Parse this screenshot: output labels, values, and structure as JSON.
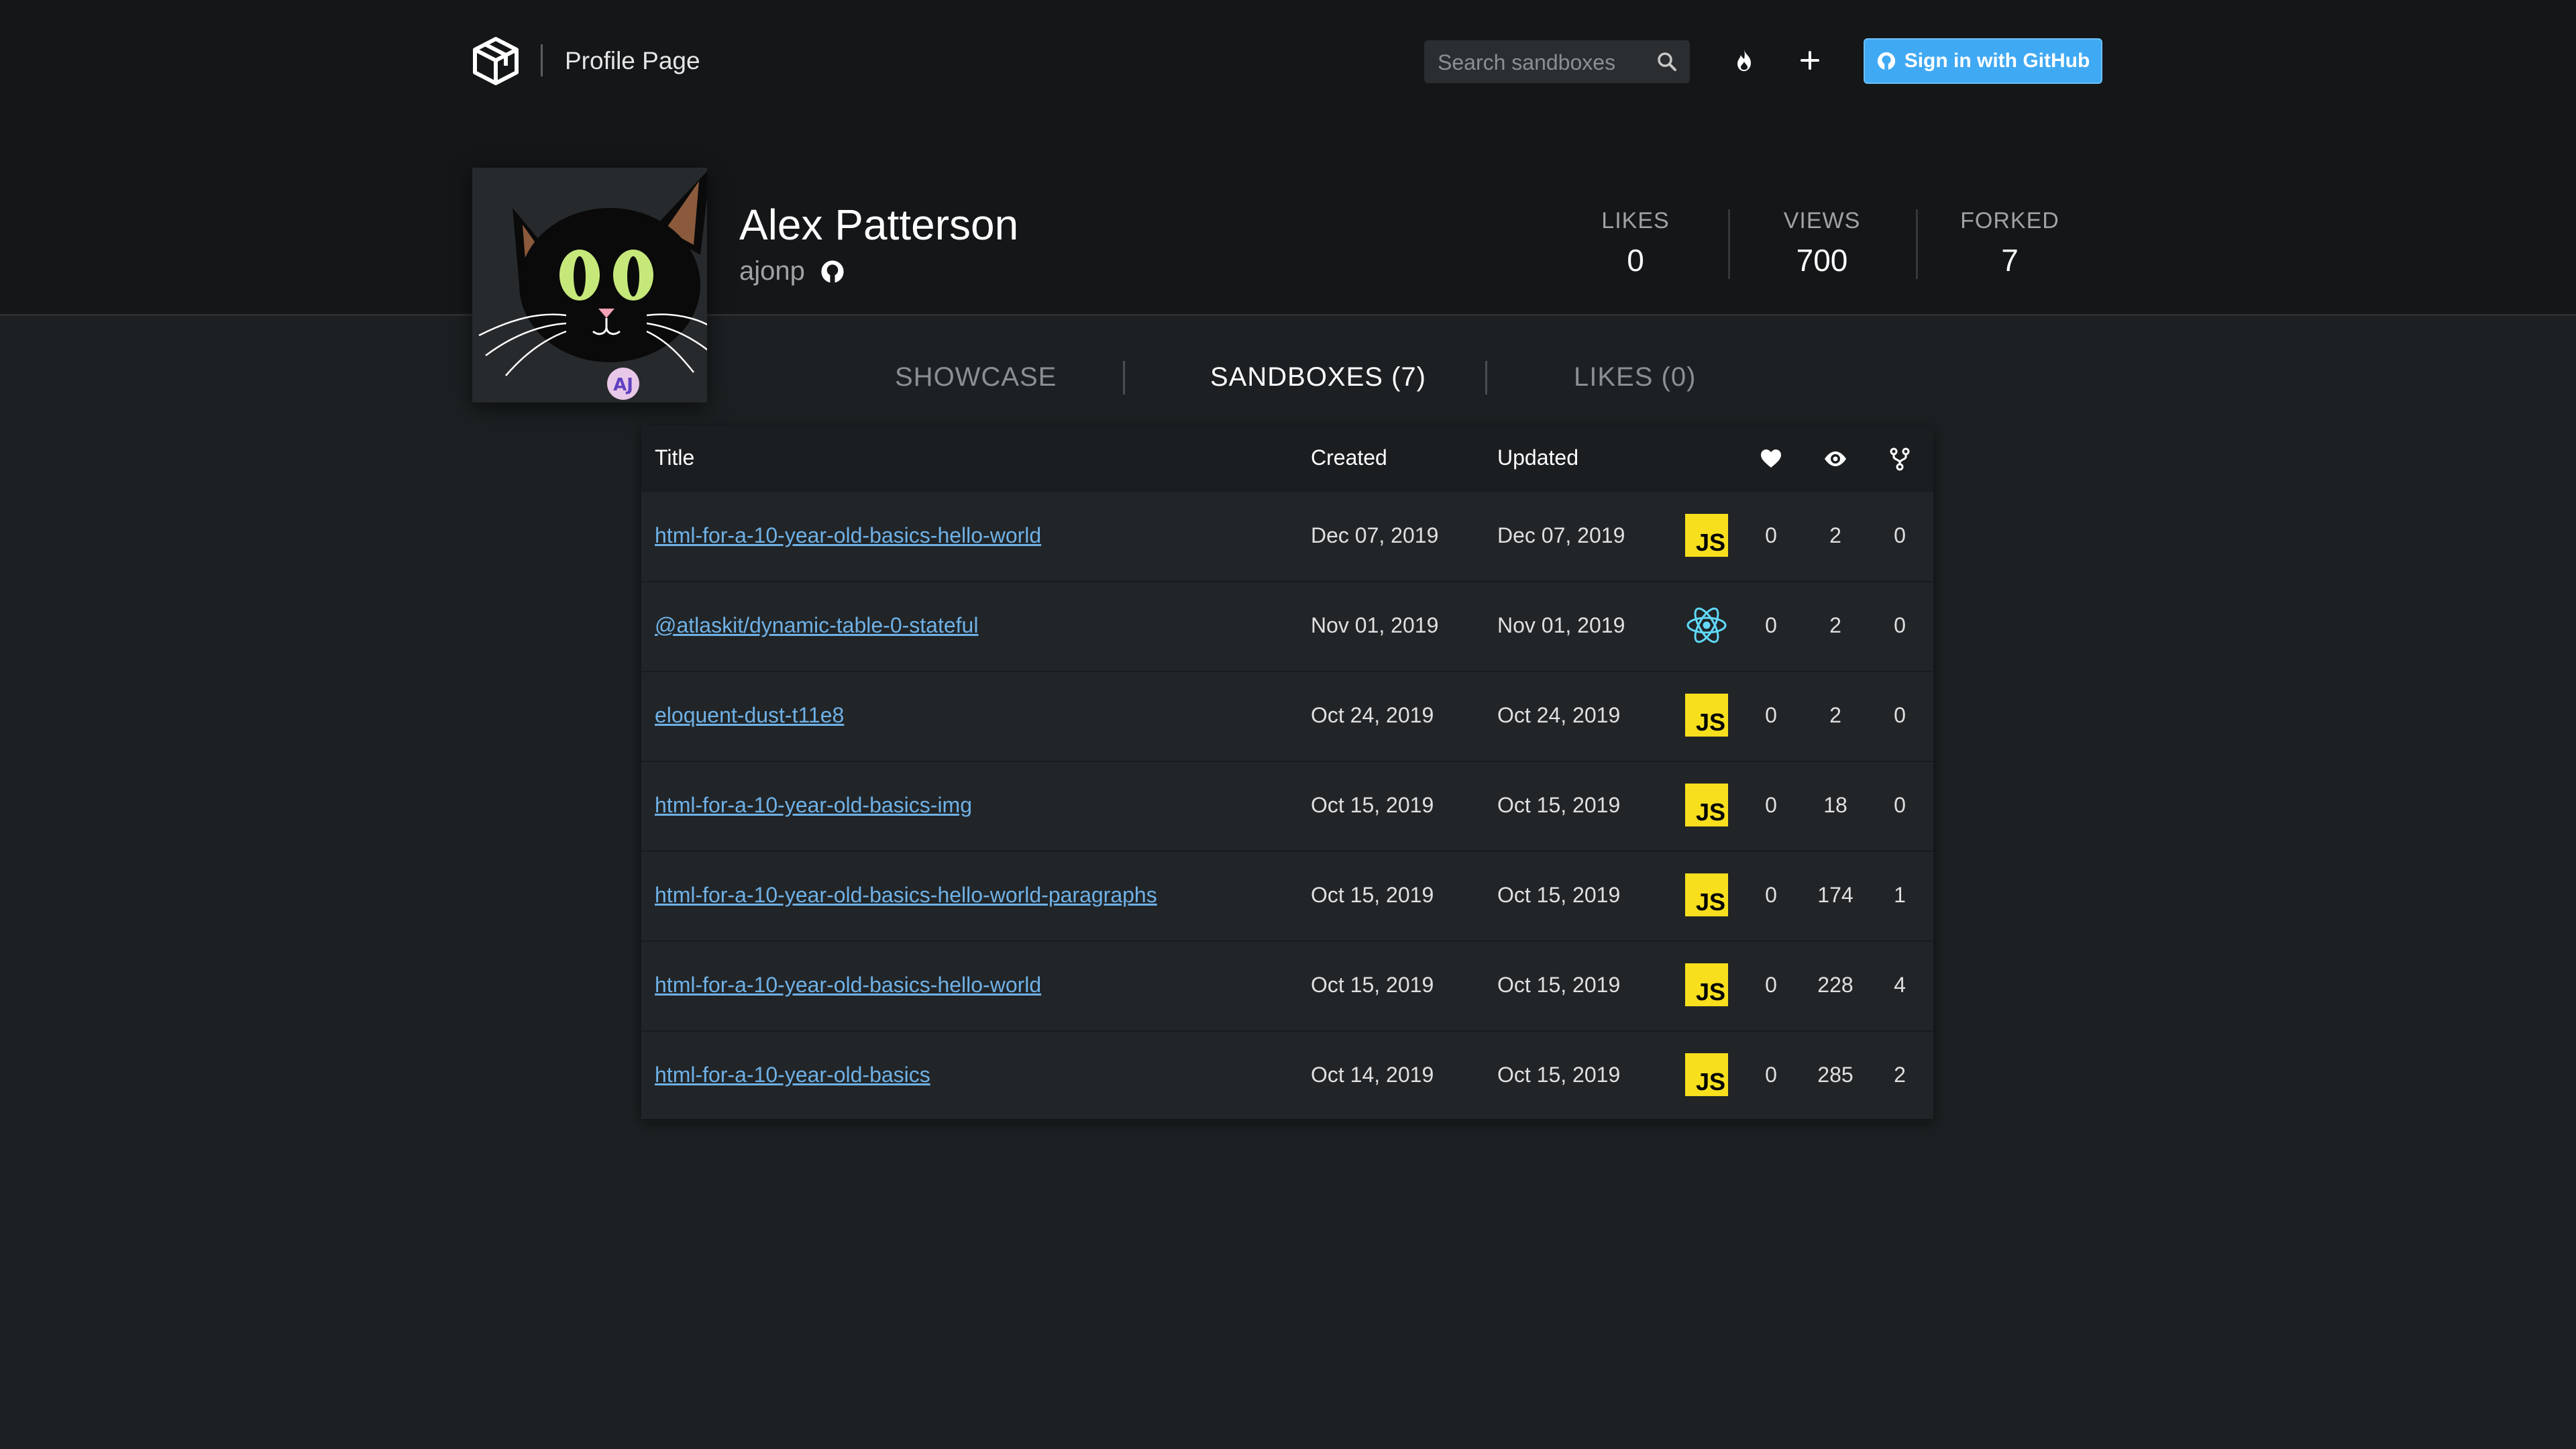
{
  "header": {
    "title": "Profile Page",
    "search_placeholder": "Search sandboxes",
    "sign_in_label": "Sign in with GitHub"
  },
  "profile": {
    "name": "Alex Patterson",
    "username": "ajonp",
    "avatar_badge": "AJ"
  },
  "stats": [
    {
      "label": "LIKES",
      "value": "0"
    },
    {
      "label": "VIEWS",
      "value": "700"
    },
    {
      "label": "FORKED",
      "value": "7"
    }
  ],
  "tabs": [
    {
      "label": "SHOWCASE"
    },
    {
      "label": "SANDBOXES (7)"
    },
    {
      "label": "LIKES (0)"
    }
  ],
  "table": {
    "columns": {
      "title": "Title",
      "created": "Created",
      "updated": "Updated"
    },
    "rows": [
      {
        "title": "html-for-a-10-year-old-basics-hello-world",
        "created": "Dec 07, 2019",
        "updated": "Dec 07, 2019",
        "template": "js-icon",
        "likes": "0",
        "views": "2",
        "forks": "0"
      },
      {
        "title": "@atlaskit/dynamic-table-0-stateful",
        "created": "Nov 01, 2019",
        "updated": "Nov 01, 2019",
        "template": "react-icon",
        "likes": "0",
        "views": "2",
        "forks": "0"
      },
      {
        "title": "eloquent-dust-t11e8",
        "created": "Oct 24, 2019",
        "updated": "Oct 24, 2019",
        "template": "js-icon",
        "likes": "0",
        "views": "2",
        "forks": "0"
      },
      {
        "title": "html-for-a-10-year-old-basics-img",
        "created": "Oct 15, 2019",
        "updated": "Oct 15, 2019",
        "template": "js-icon",
        "likes": "0",
        "views": "18",
        "forks": "0"
      },
      {
        "title": "html-for-a-10-year-old-basics-hello-world-paragraphs",
        "created": "Oct 15, 2019",
        "updated": "Oct 15, 2019",
        "template": "js-icon",
        "likes": "0",
        "views": "174",
        "forks": "1"
      },
      {
        "title": "html-for-a-10-year-old-basics-hello-world",
        "created": "Oct 15, 2019",
        "updated": "Oct 15, 2019",
        "template": "js-icon",
        "likes": "0",
        "views": "228",
        "forks": "4"
      },
      {
        "title": "html-for-a-10-year-old-basics",
        "created": "Oct 14, 2019",
        "updated": "Oct 15, 2019",
        "template": "js-icon",
        "likes": "0",
        "views": "285",
        "forks": "2"
      }
    ]
  },
  "icons": {
    "js_label": "JS"
  },
  "colors": {
    "accent": "#40a9f3",
    "link": "#6fb1e6",
    "js_yellow": "#f7df1e",
    "react_blue": "#61dafb"
  }
}
